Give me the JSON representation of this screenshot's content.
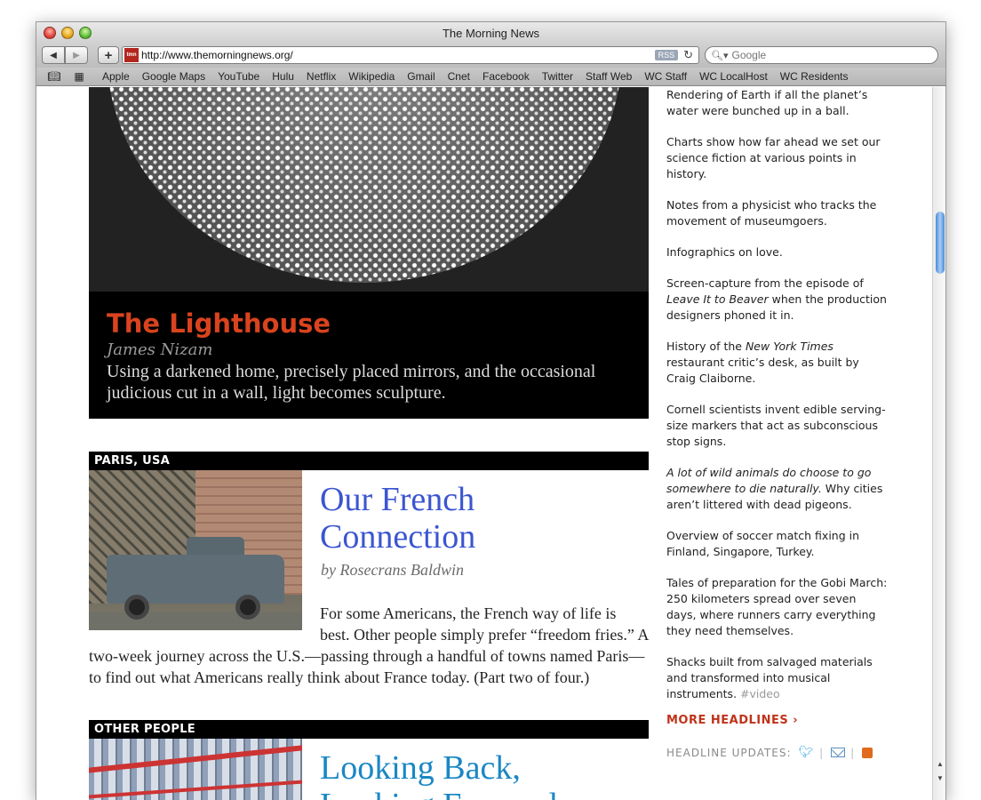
{
  "browser": {
    "title": "The Morning News",
    "url": "http://www.themorningnews.org/",
    "rss_label": "RSS",
    "search_placeholder": "Google",
    "bookmarks": [
      "Apple",
      "Google Maps",
      "YouTube",
      "Hulu",
      "Netflix",
      "Wikipedia",
      "Gmail",
      "Cnet",
      "Facebook",
      "Twitter",
      "Staff Web",
      "WC Staff",
      "WC LocalHost",
      "WC Residents"
    ]
  },
  "hero": {
    "title": "The Lighthouse",
    "author": "James Nizam",
    "description": "Using a darkened home, precisely placed mirrors, and the occasional judicious cut in a wall, light becomes sculpture."
  },
  "articles": [
    {
      "section": "PARIS, USA",
      "title_line1": "Our French",
      "title_line2": "Connection",
      "byline": "by Rosecrans Baldwin",
      "body_line1": "For some Americans, the French way of life is",
      "body_line2": "best. Other people simply prefer “freedom fries.” A",
      "body_line3": "two-week journey across the U.S.—passing through a handful of towns named Paris—",
      "body_line4": "to find out what Americans really think about France today. (Part two of four.)"
    },
    {
      "section": "OTHER PEOPLE",
      "title_line1": "Looking Back,",
      "title_line2": "Looking Forward"
    }
  ],
  "sidebar": {
    "headlines": [
      {
        "text": "Rendering of Earth if all the planet’s water were bunched up in a ball."
      },
      {
        "text": "Charts show how far ahead we set our science fiction at various points in history."
      },
      {
        "text": "Notes from a physicist who tracks the movement of museumgoers."
      },
      {
        "text": "Infographics on love."
      },
      {
        "pre": "Screen-capture from the episode of ",
        "em": "Leave It to Beaver",
        "post": " when the production designers phoned it in."
      },
      {
        "pre": "History of the ",
        "em": "New York Times",
        "post": " restaurant critic’s desk, as built by Craig Claiborne."
      },
      {
        "text": "Cornell scientists invent edible serving-size markers that act as subconscious stop signs."
      },
      {
        "pre": "",
        "em": "A lot of wild animals do choose to go somewhere to die naturally.",
        "post": " Why cities aren’t littered with dead pigeons."
      },
      {
        "text": "Overview of soccer match fixing in Finland, Singapore, Turkey."
      },
      {
        "text": "Tales of preparation for the Gobi March: 250 kilometers spread over seven days, where runners carry everything they need themselves."
      },
      {
        "text": "Shacks built from salvaged materials and transformed into musical instruments.",
        "tag": "#video"
      }
    ],
    "more_label": "MORE HEADLINES",
    "more_arrow": "›",
    "updates_label": "HEADLINE UPDATES:"
  }
}
